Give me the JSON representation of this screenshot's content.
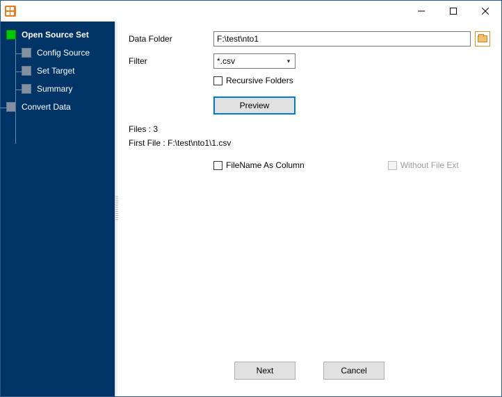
{
  "titlebar": {
    "title": ""
  },
  "sidebar": {
    "root": {
      "label": "Open Source Set"
    },
    "children": [
      {
        "label": "Config Source"
      },
      {
        "label": "Set Target"
      },
      {
        "label": "Summary"
      }
    ],
    "last": {
      "label": "Convert Data"
    }
  },
  "form": {
    "data_folder_label": "Data Folder",
    "data_folder_value": "F:\\test\\nto1",
    "filter_label": "Filter",
    "filter_value": "*.csv",
    "recursive_label": "Recursive Folders",
    "preview_label": "Preview",
    "files_count_label": "Files : 3",
    "first_file_label": "First File : F:\\test\\nto1\\1.csv",
    "filename_as_column_label": "FileName As Column",
    "without_file_ext_label": "Without File Ext"
  },
  "footer": {
    "next_label": "Next",
    "cancel_label": "Cancel"
  }
}
